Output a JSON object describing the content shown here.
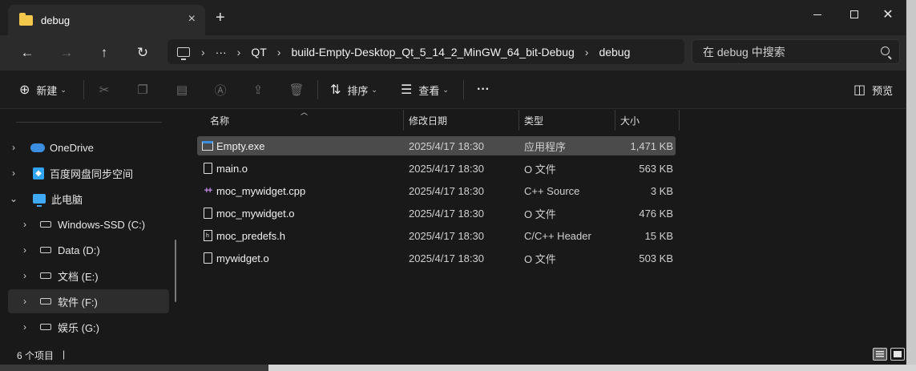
{
  "window": {
    "tab_title": "debug",
    "tab_close_icon": "×",
    "new_tab_icon": "+",
    "close_icon": "✕"
  },
  "nav": {
    "back_icon": "←",
    "forward_icon": "→",
    "up_icon": "↑",
    "refresh_icon": "↻",
    "crumb_sep": "›",
    "more": "···",
    "breadcrumbs": [
      "QT",
      "build-Empty-Desktop_Qt_5_14_2_MinGW_64_bit-Debug",
      "debug"
    ],
    "search_placeholder": "在 debug 中搜索"
  },
  "toolbar": {
    "new_label": "新建",
    "sort_label": "排序",
    "view_label": "查看",
    "more_label": "···",
    "preview_label": "预览",
    "caret": "⌄"
  },
  "sidebar": {
    "chev_right": "›",
    "chev_down": "⌄",
    "items": [
      {
        "label": "OneDrive",
        "icon": "onedrive-icon"
      },
      {
        "label": "百度网盘同步空间",
        "icon": "baidu-netdisk-icon"
      },
      {
        "label": "此电脑",
        "icon": "this-pc-icon"
      },
      {
        "label": "Windows-SSD (C:)",
        "icon": "drive-icon"
      },
      {
        "label": "Data (D:)",
        "icon": "drive-icon"
      },
      {
        "label": "文档 (E:)",
        "icon": "drive-icon"
      },
      {
        "label": "软件 (F:)",
        "icon": "drive-icon"
      },
      {
        "label": "娱乐 (G:)",
        "icon": "drive-icon"
      }
    ]
  },
  "table": {
    "columns": [
      "名称",
      "修改日期",
      "类型",
      "大小"
    ],
    "rows": [
      {
        "name": "Empty.exe",
        "date": "2025/4/17 18:30",
        "type": "应用程序",
        "size": "1,471 KB",
        "icon": "exe-icon"
      },
      {
        "name": "main.o",
        "date": "2025/4/17 18:30",
        "type": "O 文件",
        "size": "563 KB",
        "icon": "file-icon"
      },
      {
        "name": "moc_mywidget.cpp",
        "date": "2025/4/17 18:30",
        "type": "C++ Source",
        "size": "3 KB",
        "icon": "cpp-icon"
      },
      {
        "name": "moc_mywidget.o",
        "date": "2025/4/17 18:30",
        "type": "O 文件",
        "size": "476 KB",
        "icon": "file-icon"
      },
      {
        "name": "moc_predefs.h",
        "date": "2025/4/17 18:30",
        "type": "C/C++ Header",
        "size": "15 KB",
        "icon": "header-icon"
      },
      {
        "name": "mywidget.o",
        "date": "2025/4/17 18:30",
        "type": "O 文件",
        "size": "503 KB",
        "icon": "file-icon"
      }
    ]
  },
  "status": {
    "item_count": "6 个项目",
    "separator": "|"
  }
}
